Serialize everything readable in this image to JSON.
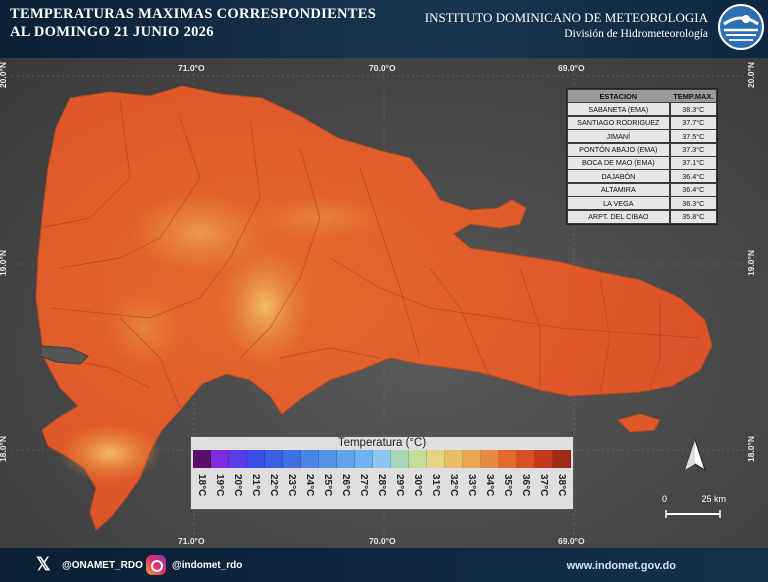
{
  "header": {
    "title_line1": "TEMPERATURAS MAXIMAS CORRESPONDIENTES",
    "title_line2": "AL DOMINGO 21  JUNIO 2026",
    "institute": "INSTITUTO DOMINICANO DE METEOROLOGIA",
    "division": "División de Hidrometeorología"
  },
  "map": {
    "lon_labels": [
      "71.0°O",
      "70.0°O",
      "69.0°O"
    ],
    "lat_labels": [
      "20.0°N",
      "19.0°N",
      "18.0°N"
    ],
    "place_labels": []
  },
  "stations_table": {
    "col_station": "ESTACION",
    "col_temp": "TEMP.MAX.",
    "rows": [
      {
        "station": "SABANETA (EMA)",
        "temp": "38.3°C"
      },
      {
        "station": "SANTIAGO RODRIGUEZ",
        "temp": "37.7°C"
      },
      {
        "station": "JIMANÍ",
        "temp": "37.5°C"
      },
      {
        "station": "PONTÓN ABAJO (EMA)",
        "temp": "37.3°C"
      },
      {
        "station": "BOCA DE MAO (EMA)",
        "temp": "37.1°C"
      },
      {
        "station": "DAJABÓN",
        "temp": "36.4°C"
      },
      {
        "station": "ALTAMIRA",
        "temp": "36.4°C"
      },
      {
        "station": "LA VEGA",
        "temp": "36.3°C"
      },
      {
        "station": "ARPT. DEL CIBAO",
        "temp": "35.8°C"
      }
    ]
  },
  "legend": {
    "title": "Temperatura (°C)",
    "classes": [
      {
        "label": "18°C",
        "color": "#5b0f6b"
      },
      {
        "label": "19°C",
        "color": "#7a2ee0"
      },
      {
        "label": "20°C",
        "color": "#5a3fe6"
      },
      {
        "label": "21°C",
        "color": "#3d4ee8"
      },
      {
        "label": "22°C",
        "color": "#3a5fe0"
      },
      {
        "label": "23°C",
        "color": "#3f72e0"
      },
      {
        "label": "24°C",
        "color": "#4c84e3"
      },
      {
        "label": "25°C",
        "color": "#5693e6"
      },
      {
        "label": "26°C",
        "color": "#61a2ea"
      },
      {
        "label": "27°C",
        "color": "#6fb2ee"
      },
      {
        "label": "28°C",
        "color": "#8cc7f0"
      },
      {
        "label": "29°C",
        "color": "#a7d6b8"
      },
      {
        "label": "30°C",
        "color": "#c7dc96"
      },
      {
        "label": "31°C",
        "color": "#e4d483"
      },
      {
        "label": "32°C",
        "color": "#e9bd63"
      },
      {
        "label": "33°C",
        "color": "#e7a64f"
      },
      {
        "label": "34°C",
        "color": "#e58a3e"
      },
      {
        "label": "35°C",
        "color": "#e26a2f"
      },
      {
        "label": "36°C",
        "color": "#d94f24"
      },
      {
        "label": "37°C",
        "color": "#c43a1e"
      },
      {
        "label": "38°C",
        "color": "#9e2a18"
      }
    ]
  },
  "scale_bar": {
    "start": "0",
    "end": "25 km"
  },
  "footer": {
    "twitter": "@ONAMET_RDO",
    "instagram": "@indomet_rdo",
    "website": "www.indomet.gov.do"
  },
  "colors": {
    "land_hot": "#e0592b",
    "land_warm": "#eb8a3c",
    "land_mild": "#f2c463",
    "sea": "#4a4a4a",
    "header_bg": "#1a3550"
  },
  "icons": [
    "x-logo-icon",
    "instagram-icon",
    "north-arrow-icon",
    "indomet-logo-icon"
  ]
}
